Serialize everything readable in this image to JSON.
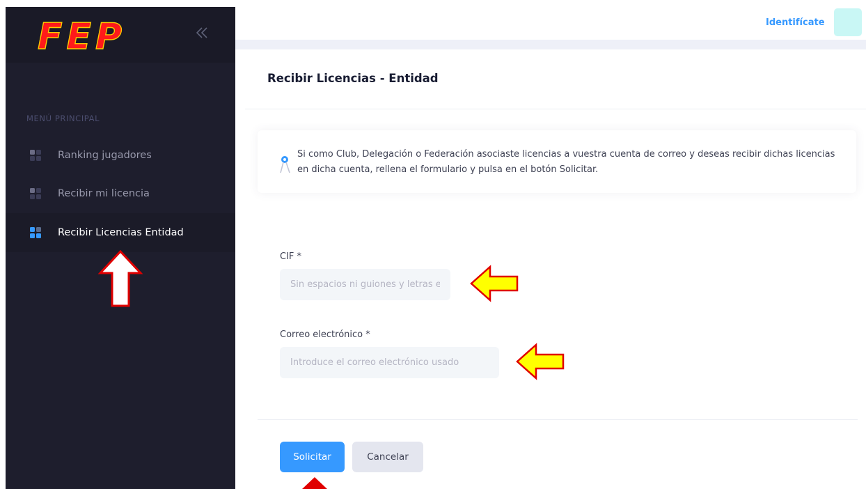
{
  "sidebar": {
    "logo_text": "FEP",
    "section_title": "MENÚ PRINCIPAL",
    "items": [
      {
        "label": "Ranking jugadores",
        "icon": "grid-icon",
        "active": false
      },
      {
        "label": "Recibir mi licencia",
        "icon": "grid-icon",
        "active": false
      },
      {
        "label": "Recibir Licencias Entidad",
        "icon": "grid-icon",
        "active": true
      }
    ]
  },
  "header": {
    "login_label": "Identifícate"
  },
  "card": {
    "title": "Recibir Licencias - Entidad",
    "alert_text": "Si como Club, Delegación o Federación asociaste licencias a vuestra cuenta de correo y deseas recibir dichas licencias en dicha cuenta, rellena el formulario y pulsa en el botón Solicitar.",
    "fields": {
      "cif": {
        "label": "CIF *",
        "placeholder": "Sin espacios ni guiones y letras en mayúscula",
        "value": ""
      },
      "email": {
        "label": "Correo electrónico *",
        "placeholder": "Introduce el correo electrónico usado",
        "value": ""
      }
    },
    "buttons": {
      "submit": "Solicitar",
      "cancel": "Cancelar"
    }
  },
  "colors": {
    "sidebar_bg": "#1e1e2d",
    "primary": "#3699ff",
    "annotation_red": "#e00000",
    "annotation_yellow": "#ffff00"
  }
}
